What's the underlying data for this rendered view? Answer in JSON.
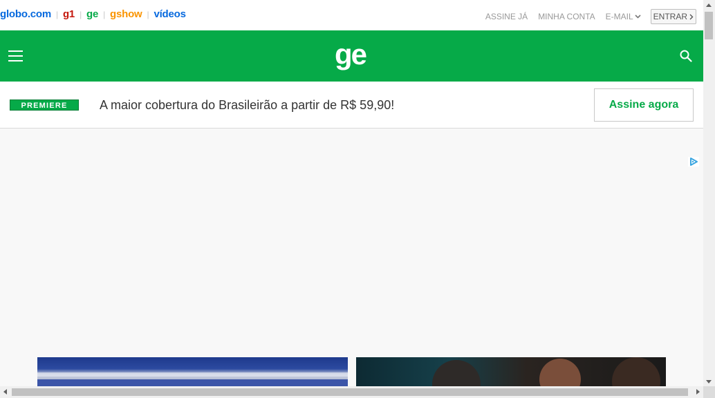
{
  "globo_bar": {
    "brands": {
      "globo": "globo.com",
      "g1": "g1",
      "ge": "ge",
      "gshow": "gshow",
      "videos": "vídeos"
    },
    "separator": "|",
    "account": {
      "subscribe": "ASSINE JÁ",
      "my_account": "MINHA CONTA",
      "email": "E-MAIL",
      "login": "ENTRAR"
    }
  },
  "header": {
    "logo": "ge",
    "background_color": "#06aa48"
  },
  "premiere_banner": {
    "logo_text": "PREMIERE",
    "text": "A maior cobertura do Brasileirão a partir de R$ 59,90!",
    "cta": "Assine agora"
  },
  "ad": {
    "icon": "adchoices-icon"
  },
  "icons": {
    "menu": "hamburger-menu-icon",
    "search": "search-icon",
    "email_dropdown": "chevron-down-icon",
    "login_arrow": "chevron-right-icon"
  },
  "colors": {
    "brand_green": "#06aa48",
    "globo_blue": "#0669de",
    "g1_red": "#c4170c",
    "gshow_orange": "#fa9400"
  }
}
